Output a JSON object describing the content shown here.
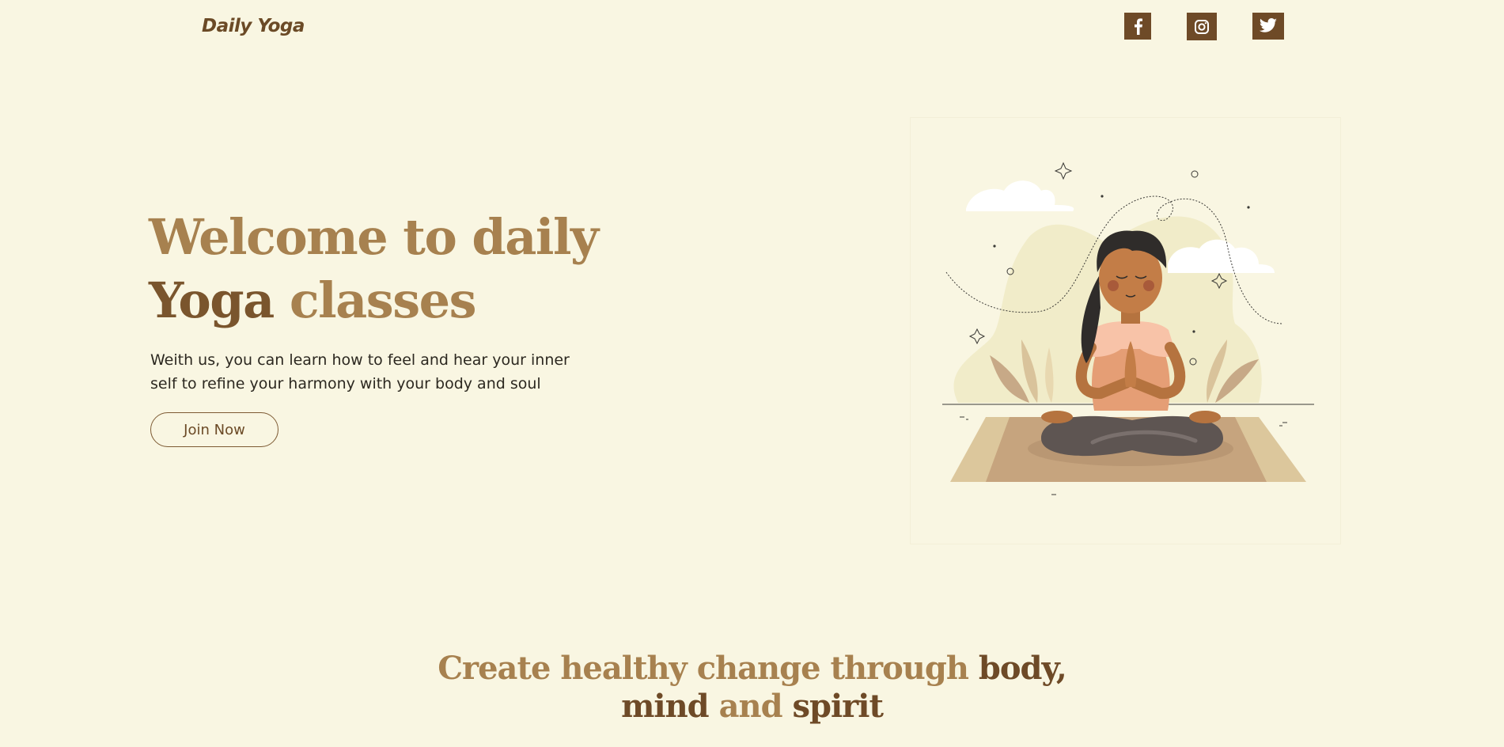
{
  "header": {
    "brand": "Daily Yoga",
    "social": [
      {
        "name": "facebook",
        "icon": "facebook-icon"
      },
      {
        "name": "instagram",
        "icon": "instagram-icon"
      },
      {
        "name": "twitter",
        "icon": "twitter-icon"
      }
    ]
  },
  "hero": {
    "title_part1": "Welcome to daily",
    "title_part2": "Yoga",
    "title_part3": " classes",
    "subtitle": "Weith us, you can learn how to feel and hear your inner self to refine your harmony with your body and soul",
    "cta_label": "Join Now",
    "illustration": "woman-meditating-illustration"
  },
  "section": {
    "title_part1": "Create healthy change through ",
    "title_part2": "body,",
    "title_part3": "mind",
    "title_part4": " and ",
    "title_part5": "spirit"
  },
  "colors": {
    "background": "#f9f6e2",
    "brown_dark": "#6e4a27",
    "brown_light": "#a7814f",
    "text": "#2c2820"
  }
}
